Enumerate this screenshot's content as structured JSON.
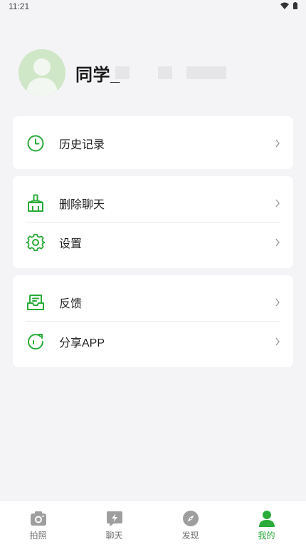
{
  "status_bar": {
    "time": "11:21",
    "icons": [
      "wifi-icon",
      "battery-icon"
    ]
  },
  "profile": {
    "name": "同学_",
    "avatar_icon": "default-avatar-icon"
  },
  "colors": {
    "accent": "#2bab3a",
    "background": "#f4f4f7",
    "card": "#ffffff",
    "inactive_tab": "#6f6f6f"
  },
  "menu": {
    "history": {
      "label": "历史记录",
      "icon": "clock-icon"
    },
    "delete_chat": {
      "label": "删除聊天",
      "icon": "broom-icon"
    },
    "settings": {
      "label": "设置",
      "icon": "gear-icon"
    },
    "feedback": {
      "label": "反馈",
      "icon": "feedback-inbox-icon"
    },
    "share": {
      "label": "分享APP",
      "icon": "share-refresh-icon"
    }
  },
  "tabs": [
    {
      "label": "拍照",
      "icon": "camera-icon",
      "active": false
    },
    {
      "label": "聊天",
      "icon": "chat-bolt-icon",
      "active": false
    },
    {
      "label": "发现",
      "icon": "compass-icon",
      "active": false
    },
    {
      "label": "我的",
      "icon": "person-icon",
      "active": true
    }
  ]
}
